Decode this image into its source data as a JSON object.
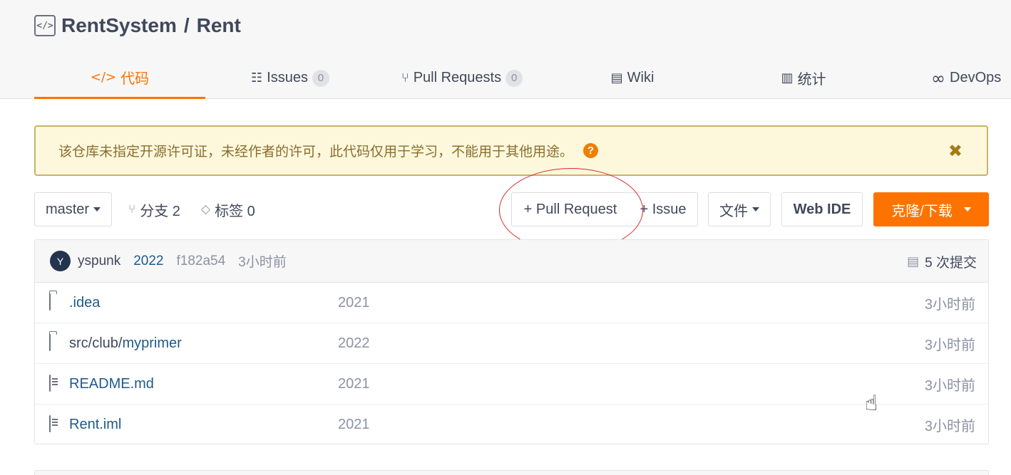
{
  "repo": {
    "owner": "RentSystem",
    "separator": "/",
    "name": "Rent",
    "icon": "code-brackets-icon"
  },
  "tabs": [
    {
      "label": "代码",
      "icon": "code-icon",
      "active": true
    },
    {
      "label": "Issues",
      "icon": "issues-icon",
      "badge": "0"
    },
    {
      "label": "Pull Requests",
      "icon": "pull-request-icon",
      "badge": "0"
    },
    {
      "label": "Wiki",
      "icon": "book-icon"
    },
    {
      "label": "统计",
      "icon": "bar-chart-icon"
    },
    {
      "label": "DevOps",
      "icon": "infinity-icon"
    }
  ],
  "notice": {
    "text": "该仓库未指定开源许可证，未经作者的许可，此代码仅用于学习，不能用于其他用途。"
  },
  "toolbar": {
    "branch": "master",
    "branches_label": "分支 2",
    "tags_label": "标签 0",
    "pull_request_btn": "+ Pull Request",
    "issue_btn": "+ Issue",
    "files_btn": "文件",
    "webide_btn": "Web IDE",
    "clone_btn": "克隆/下载"
  },
  "commit": {
    "avatar_letter": "Y",
    "author": "yspunk",
    "message": "2022",
    "hash": "f182a54",
    "time": "3小时前",
    "commits_label": "5 次提交"
  },
  "files": [
    {
      "type": "folder",
      "prefix": "",
      "name": ".idea",
      "commit": "2021",
      "time": "3小时前"
    },
    {
      "type": "folder",
      "prefix": "src/club/",
      "name": "myprimer",
      "commit": "2022",
      "time": "3小时前"
    },
    {
      "type": "file",
      "prefix": "",
      "name": "README.md",
      "commit": "2021",
      "time": "3小时前"
    },
    {
      "type": "file",
      "prefix": "",
      "name": "Rent.iml",
      "commit": "2021",
      "time": "3小时前"
    }
  ],
  "colors": {
    "accent": "#fe7300",
    "link": "#1f5a8a",
    "notice_bg": "#fdf8dc",
    "annotation": "#d62a2a"
  }
}
